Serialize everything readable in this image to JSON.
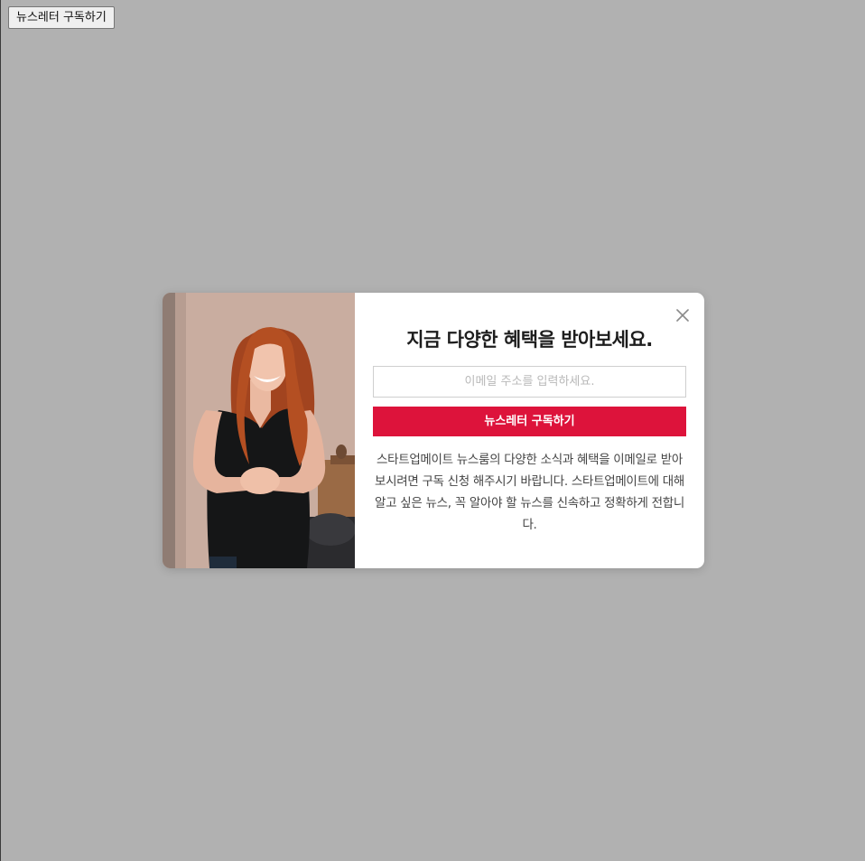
{
  "page": {
    "open_button_label": "뉴스레터 구독하기"
  },
  "modal": {
    "photo": {
      "icon": "smiling-woman-photo"
    },
    "close_icon": "close-icon",
    "title": "지금 다양한 혜택을 받아보세요.",
    "email": {
      "value": "",
      "placeholder": "이메일 주소를 입력하세요."
    },
    "subscribe_label": "뉴스레터 구독하기",
    "description": "스타트업메이트 뉴스룸의 다양한 소식과 혜택을 이메일로 받아 보시려면 구독 신청 해주시기 바랍니다. 스타트업메이트에 대해 알고 싶은 뉴스, 꼭 알아야 할 뉴스를 신속하고 정확하게 전합니다."
  },
  "colors": {
    "overlay": "#b1b1b1",
    "accent": "#dd133b",
    "title": "#1d1d1d",
    "body_text": "#444444"
  }
}
